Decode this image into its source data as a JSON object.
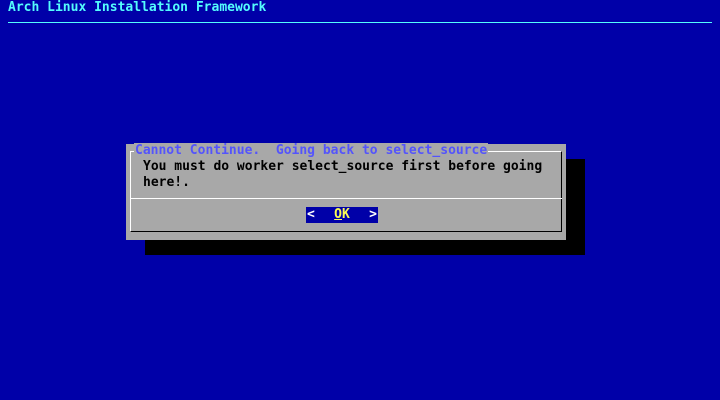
{
  "backtitle": "Arch Linux Installation Framework",
  "dialog": {
    "title": "Cannot Continue.  Going back to select_source",
    "message": "You must do worker select_source first before going here!.",
    "ok_button": {
      "left_bracket": "<",
      "hotkey": "O",
      "rest": "K",
      "right_bracket": ">"
    }
  },
  "colors": {
    "screen_background": "#0000a8",
    "backtitle": "#54fcfc",
    "dialog_background": "#a8a8a8",
    "dialog_title": "#5454fc",
    "button_background": "#0000a8",
    "button_text": "#fcfc54"
  }
}
